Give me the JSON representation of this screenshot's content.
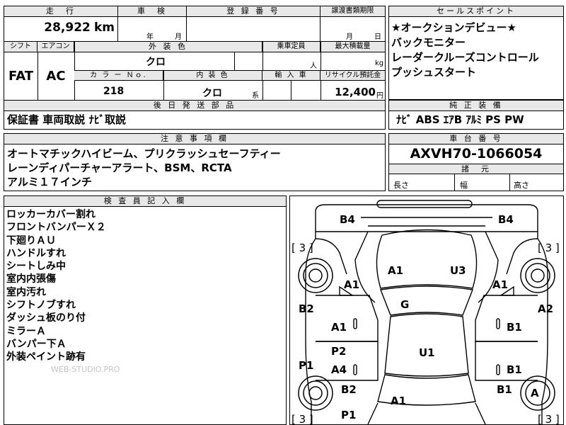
{
  "top": {
    "mileage_header": "走　行",
    "inspection_header": "車　検",
    "registration_header": "登 録 番 号",
    "transfer_header": "譲渡書類期限",
    "mileage_value": "28,922",
    "mileage_unit": "km",
    "inspection_year": "年",
    "inspection_month": "月",
    "transfer_month": "月",
    "transfer_day": "日"
  },
  "specs": {
    "shift_header": "シフト",
    "ac_header": "エアコン",
    "exterior_color_header": "外 装 色",
    "capacity_header": "乗車定員",
    "load_header": "最大積載量",
    "shift_value": "FAT",
    "ac_value": "AC",
    "exterior_color_value": "クロ",
    "capacity_unit": "人",
    "load_unit": "kg",
    "color_no_header": "カ ラ ー Ｎｏ.",
    "interior_color_header": "内 装 色",
    "import_header": "輸 入 車",
    "recycle_header": "リサイクル預託金",
    "color_no_value": "218",
    "interior_color_value": "クロ",
    "interior_color_suffix": "系",
    "recycle_value": "12,400",
    "recycle_unit": "円"
  },
  "sales_points": {
    "header": "セールスポイント",
    "lines": [
      "★オークションデビュー★",
      "バックモニター",
      "レーダークルーズコントロール",
      "プッシュスタート"
    ]
  },
  "accessories": {
    "header": "後 日 発 送 部 品",
    "text": "保証書 車両取説 ﾅﾋﾞ取説"
  },
  "equipment": {
    "header": "純 正 装 備",
    "text": "ﾅﾋﾞ ABS ｴｱB ｱﾙﾐ PS PW"
  },
  "notes": {
    "header": "注 意 事 項 欄",
    "lines": [
      "オートマチックハイビーム、プリクラッシュセーフティー",
      "レーンディパーチャーアラート、BSM、RCTA",
      "アルミ１７インチ"
    ]
  },
  "chassis": {
    "header": "車 台 番 号",
    "value": "AXVH70-1066054",
    "dims_header": "諸　元",
    "length_label": "長さ",
    "width_label": "幅",
    "height_label": "高さ"
  },
  "inspector": {
    "header": "検 査 員 記 入 欄",
    "lines": [
      "ロッカーカバー割れ",
      "フロントバンパーＸ２",
      "下廻りＡＵ",
      "ハンドルすれ",
      "シートしみ中",
      "室内内張傷",
      "室内汚れ",
      "シフトノブすれ",
      "ダッシュ板のり付",
      "ミラーＡ",
      "バンパー下Ａ",
      "外装ペイント跡有"
    ],
    "watermark": "WEB-STUDIO.PRO"
  },
  "diagram": {
    "tire_marks": [
      "[ 3 ]",
      "[ 3 ]",
      "[ 3 ]",
      "[ 3 ]"
    ],
    "codes": {
      "b4_left": "B4",
      "b4_right": "B4",
      "a1_hood_left": "A1",
      "u3_hood": "U3",
      "a1_front_left_fender": "A1",
      "a1_front_right_fender": "A1",
      "b2_left": "B2",
      "a2_right": "A2",
      "g_windshield": "G",
      "a1_left_front_door": "A1",
      "b1_right_front_door": "B1",
      "p2_left": "P2",
      "u1_roof": "U1",
      "p1_left_side": "P1",
      "a4_left_rear_door": "A4",
      "b1_right_rear_door": "B1",
      "b2_left_rear": "B2",
      "b1_right_rear": "B1",
      "a_right_rear_wheel": "A",
      "p1_left_rear": "P1",
      "a1_rear": "A1"
    }
  }
}
